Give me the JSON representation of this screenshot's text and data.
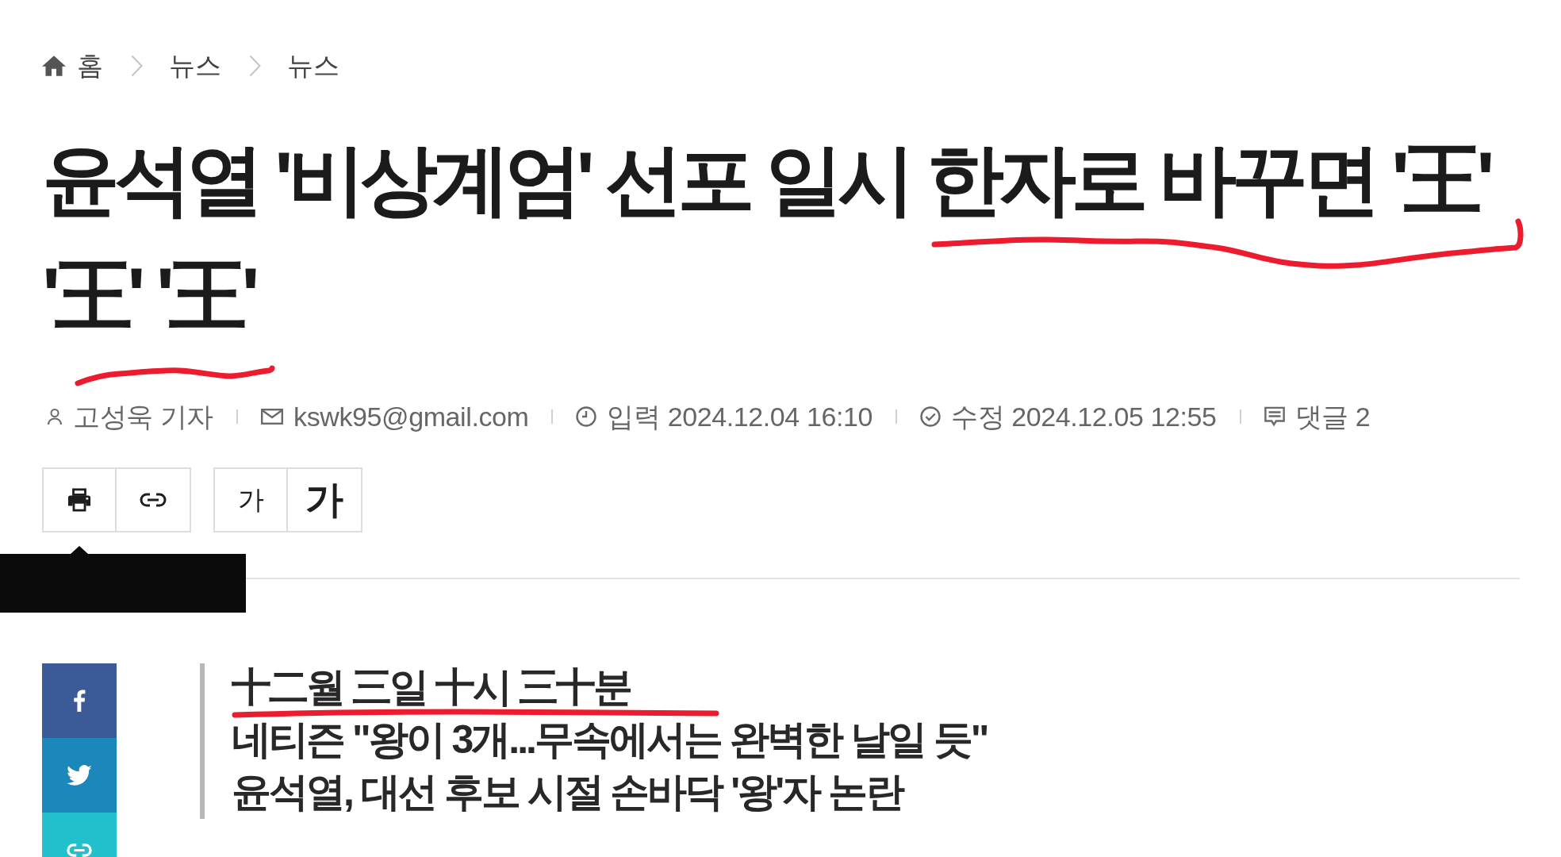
{
  "breadcrumb": [
    {
      "kind": "home",
      "label": "홈"
    },
    {
      "kind": "section",
      "label": "뉴스"
    },
    {
      "kind": "section",
      "label": "뉴스"
    }
  ],
  "article": {
    "title": {
      "text": "윤석열 '비상계엄' 선포 일시 한자로 바꾸면 '王' '王' '王'",
      "annotated": true
    },
    "meta": [
      {
        "kind": "author",
        "text": "고성욱 기자"
      },
      {
        "kind": "email",
        "text": "kswk95@gmail.com"
      },
      {
        "kind": "published",
        "text": "입력 2024.12.04 16:10"
      },
      {
        "kind": "updated",
        "text": "수정 2024.12.05 12:55"
      },
      {
        "kind": "comments",
        "text": "댓글 2"
      }
    ],
    "tools": [
      {
        "kind": "print",
        "tooltip_open": true
      },
      {
        "kind": "link",
        "tooltip_open": false
      }
    ],
    "text_size_buttons": [
      {
        "kind": "smaller",
        "label": "가"
      },
      {
        "kind": "larger",
        "label": "가"
      }
    ],
    "share_buttons": [
      {
        "kind": "facebook"
      },
      {
        "kind": "twitter"
      },
      {
        "kind": "link"
      }
    ],
    "subtitle_lines": [
      {
        "text": "十二월 三일 十시 三十분",
        "annotated": true
      },
      {
        "text": "네티즌 \"왕이 3개...무속에서는 완벽한 날일 듯\"",
        "annotated": false
      },
      {
        "text": "윤석열, 대선 후보 시절 손바닥 '왕'자 논란",
        "annotated": false
      }
    ]
  }
}
